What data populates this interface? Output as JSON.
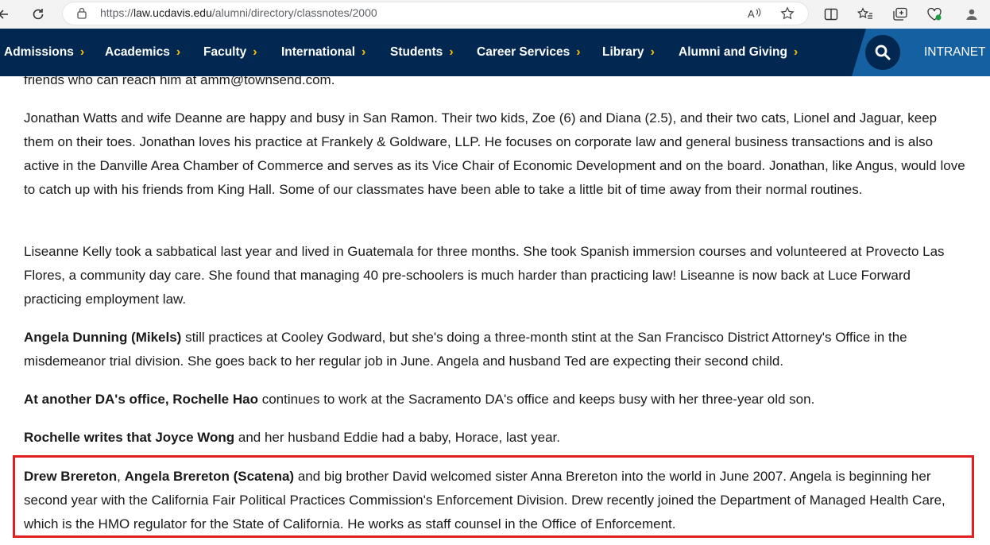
{
  "browser": {
    "url_prefix": "https://",
    "url_host": "law.ucdavis.edu",
    "url_path": "/alumni/directory/classnotes/2000"
  },
  "nav": {
    "items": [
      "Admissions",
      "Academics",
      "Faculty",
      "International",
      "Students",
      "Career Services",
      "Library",
      "Alumni and Giving"
    ],
    "chevron": "›",
    "intranet": "INTRANET",
    "colors": {
      "bar": "#022851",
      "accent": "#ffbf00",
      "intranet_bg": "#1560a0"
    }
  },
  "content": {
    "p0": "friends who can reach him at amm@townsend.com.",
    "p1": "Jonathan Watts and wife Deanne are happy and busy in San Ramon. Their two kids, Zoe (6) and Diana (2.5), and their two cats, Lionel and Jaguar, keep them on their toes. Jonathan loves his practice at Frankely & Goldware, LLP. He focuses on corporate law and general business transactions and is also active in the Danville Area Chamber of Commerce and serves as its Vice Chair of Economic Development and on the board. Jonathan, like Angus, would love to catch up with his friends from King Hall. Some of our classmates have been able to take a little bit of time away from their normal routines.",
    "p2": "Liseanne Kelly took a sabbatical last year and lived in Guatemala for three months. She took Spanish immersion courses and volunteered at Provecto Las Flores, a community day care. She found that managing 40 pre-schoolers is much harder than practicing law! Liseanne is now back at Luce Forward practicing employment law.",
    "p3_bold": "Angela Dunning (Mikels)",
    "p3_rest": " still practices at Cooley Godward, but she's doing a three-month stint at the San Francisco District Attorney's Office in the misdemeanor trial division. She goes back to her regular job in June. Angela and husband Ted are expecting their second child.",
    "p4_bold": "At another DA's office, Rochelle Hao",
    "p4_rest": " continues to work at the Sacramento DA's office and keeps busy with her three-year old son.",
    "p5_bold": "Rochelle writes that Joyce Wong",
    "p5_rest": " and her husband Eddie had a baby, Horace, last year.",
    "p6_bold1": "Drew Brereton",
    "p6_sep": ", ",
    "p6_bold2": "Angela Brereton (Scatena)",
    "p6_rest": " and big brother David welcomed sister Anna Brereton into the world in June 2007. Angela is beginning her second year with the California Fair Political Practices Commission's Enforcement Division. Drew recently joined the Department of Managed Health Care, which is the HMO regulator for the State of California. He works as staff counsel in the Office of Enforcement."
  },
  "highlight_color": "#e02020"
}
